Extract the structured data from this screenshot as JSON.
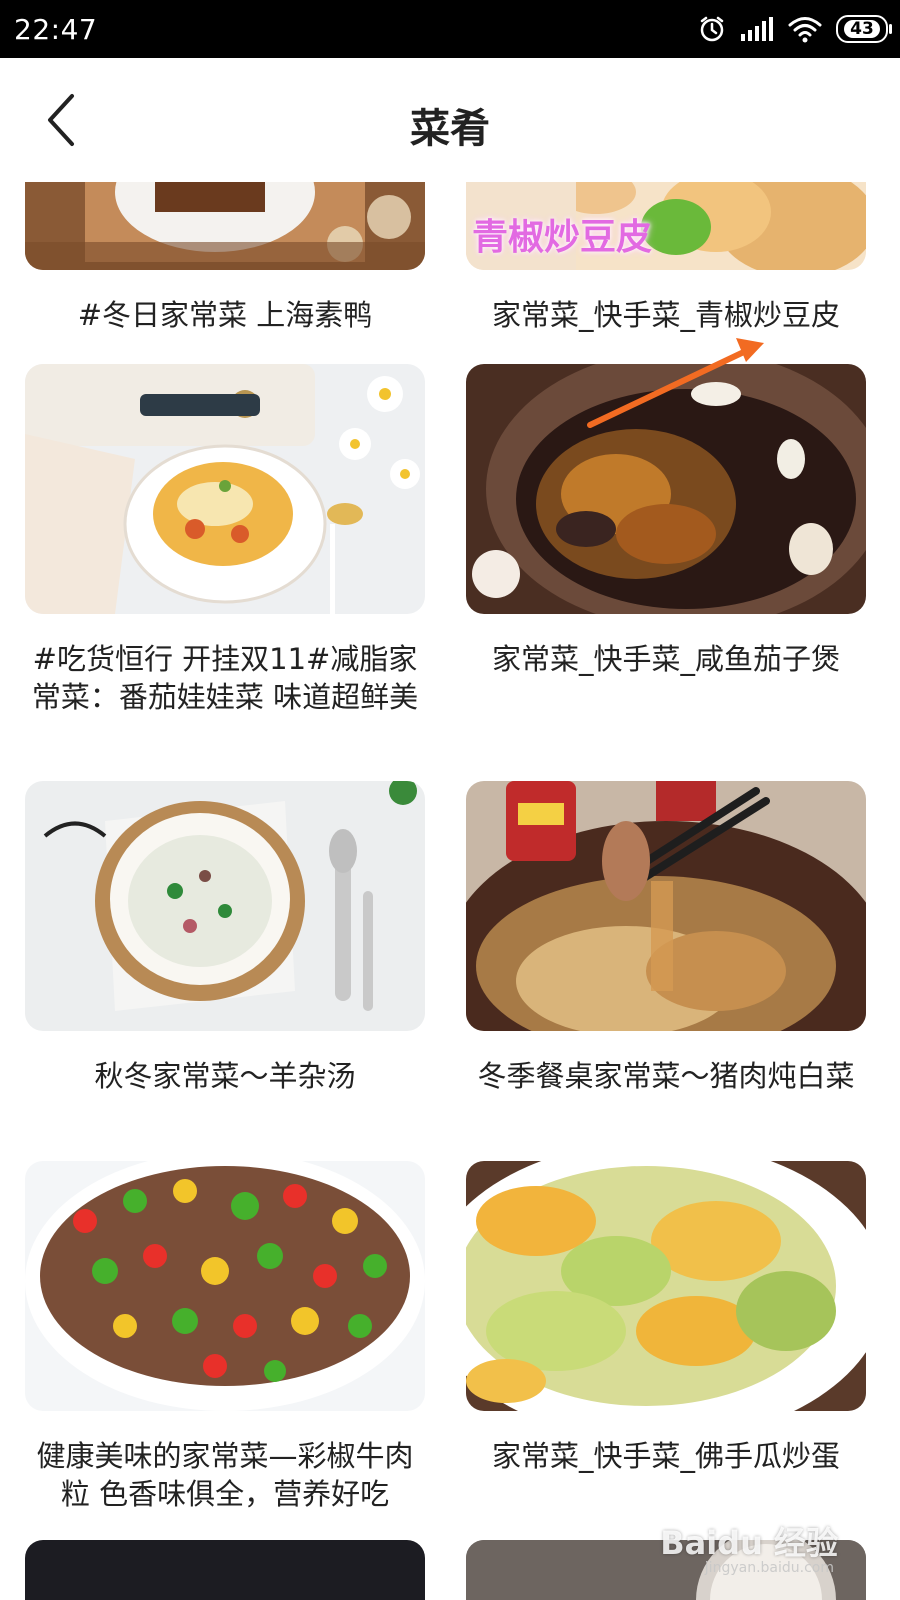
{
  "status_bar": {
    "time": "22:47",
    "battery": "43"
  },
  "header": {
    "title": "菜肴"
  },
  "recipes": [
    {
      "title": "#冬日家常菜 上海素鸭"
    },
    {
      "title": "家常菜_快手菜_青椒炒豆皮",
      "thumb_text": "青椒炒豆皮"
    },
    {
      "title": "#吃货恒行 开挂双11#减脂家常菜：番茄娃娃菜 味道超鲜美"
    },
    {
      "title": "家常菜_快手菜_咸鱼茄子煲"
    },
    {
      "title": "秋冬家常菜～羊杂汤"
    },
    {
      "title": "冬季餐桌家常菜～猪肉炖白菜"
    },
    {
      "title": "健康美味的家常菜—彩椒牛肉粒  色香味俱全，营养好吃"
    },
    {
      "title": "家常菜_快手菜_佛手瓜炒蛋"
    }
  ],
  "watermark": {
    "main": "Baidu 经验",
    "sub": "jingyan.baidu.com"
  },
  "colors": {
    "status_bar_bg": "#000000",
    "annotation_arrow": "#f26b22"
  }
}
